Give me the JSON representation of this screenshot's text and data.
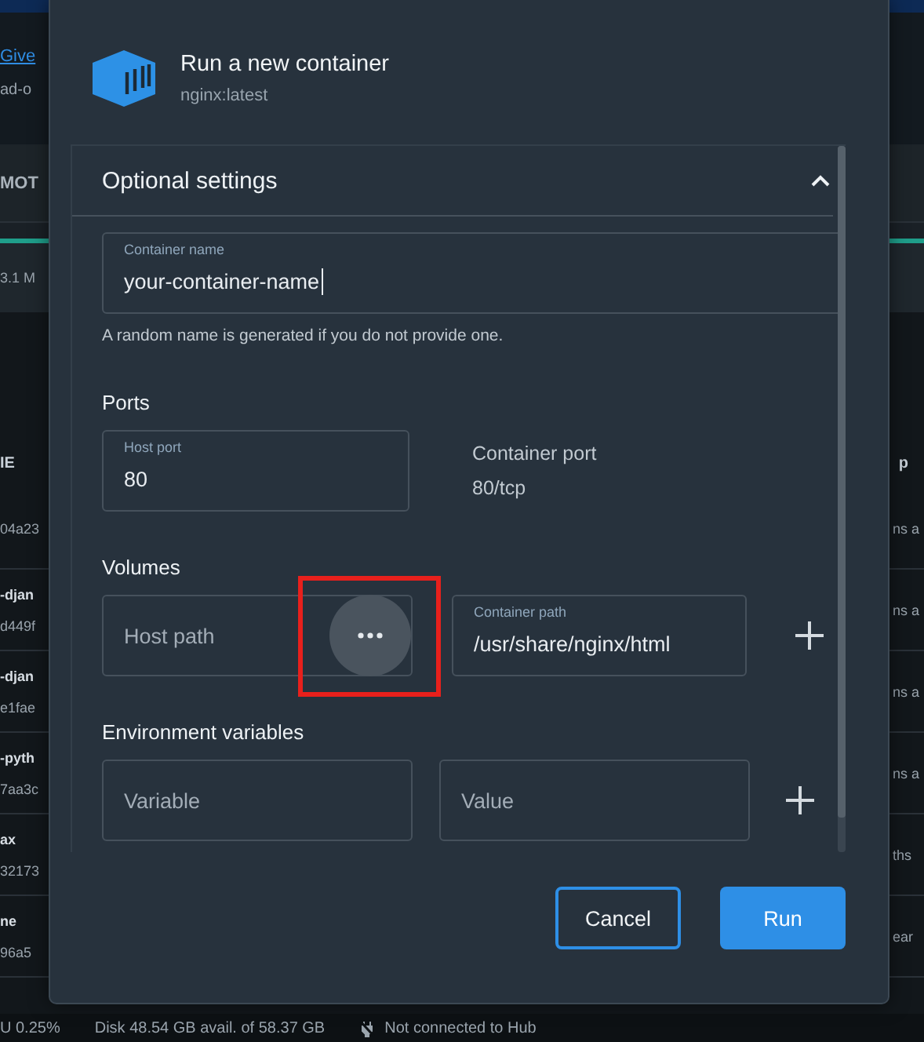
{
  "background_app": {
    "link": "Give",
    "subtitle": "ad-o",
    "tab": "MOT",
    "stat": "3.1 M",
    "header_left": "IE",
    "header_right": "p",
    "rows": [
      {
        "id": "04a23",
        "time": "ns a"
      },
      {
        "name": "-djan",
        "id": "d449f",
        "time": "ns a"
      },
      {
        "name": "-djan",
        "id": "e1fae",
        "time": "ns a"
      },
      {
        "name": "-pyth",
        "id": "7aa3c",
        "time": "ns a"
      },
      {
        "name": "ax",
        "id": "32173",
        "time": "ths"
      },
      {
        "name": "ne",
        "id": "96a5",
        "time": "ear"
      }
    ]
  },
  "status_bar": {
    "cpu": "U 0.25%",
    "disk": "Disk 48.54 GB avail. of 58.37 GB",
    "hub": "Not connected to Hub"
  },
  "dialog": {
    "title": "Run a new container",
    "subtitle": "nginx:latest",
    "section": {
      "title": "Optional settings",
      "expanded": true,
      "container_name": {
        "label": "Container name",
        "value": "your-container-name",
        "help": "A random name is generated if you do not provide one."
      },
      "ports": {
        "heading": "Ports",
        "host": {
          "label": "Host port",
          "value": "80"
        },
        "container_label": "Container port",
        "container_value": "80/tcp"
      },
      "volumes": {
        "heading": "Volumes",
        "host": {
          "placeholder": "Host path"
        },
        "browse_highlighted": true,
        "container": {
          "label": "Container path",
          "value": "/usr/share/nginx/html"
        }
      },
      "environment": {
        "heading": "Environment variables",
        "variable": {
          "placeholder": "Variable"
        },
        "value": {
          "placeholder": "Value"
        }
      }
    },
    "buttons": [
      {
        "label": "Cancel",
        "kind": "secondary"
      },
      {
        "label": "Run",
        "kind": "primary"
      }
    ]
  }
}
